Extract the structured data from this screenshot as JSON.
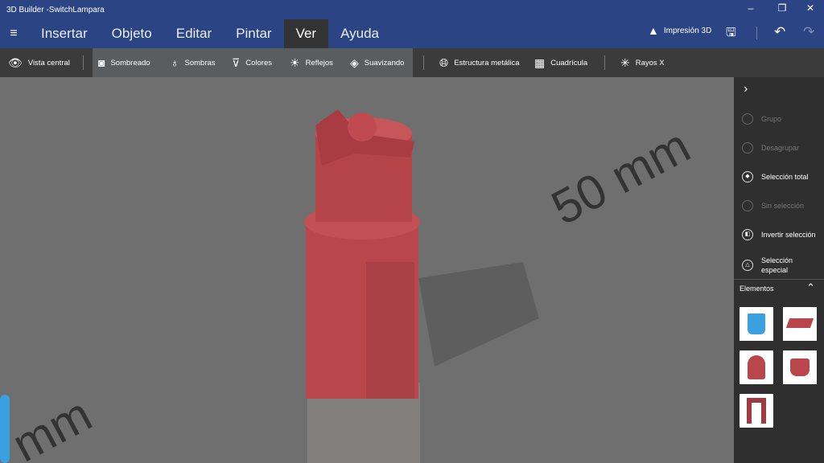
{
  "window": {
    "title": "3D Builder -SwitchLampara",
    "minimize": "–",
    "restore": "❐",
    "close": "✕"
  },
  "menu": {
    "items": [
      "Insertar",
      "Objeto",
      "Editar",
      "Pintar",
      "Ver",
      "Ayuda"
    ],
    "active": "Ver"
  },
  "header_right": {
    "print_label": "Impresión 3D"
  },
  "toolbar": {
    "vista_central": "Vista central",
    "sombreado": "Sombreado",
    "sombras": "Sombras",
    "colores": "Colores",
    "reflejos": "Reflejos",
    "suavizando": "Suavizando",
    "estructura": "Estructura metálica",
    "cuadricula": "Cuadrícula",
    "rayos": "Rayos X"
  },
  "sidebar": {
    "items": [
      {
        "label": "Grupo",
        "enabled": false
      },
      {
        "label": "Desagrupar",
        "enabled": false
      },
      {
        "label": "Selección total",
        "enabled": true
      },
      {
        "label": "Sin selección",
        "enabled": false
      },
      {
        "label": "Invertir selección",
        "enabled": true
      },
      {
        "label": "Selección especial",
        "enabled": true
      }
    ],
    "elements_title": "Elementos"
  },
  "viewport": {
    "ruler_label_1": "50 mm",
    "ruler_label_2": "mm"
  },
  "colors": {
    "titlebar": "#2b4483",
    "model": "#b8464a",
    "element_blue": "#3aa0e0"
  }
}
